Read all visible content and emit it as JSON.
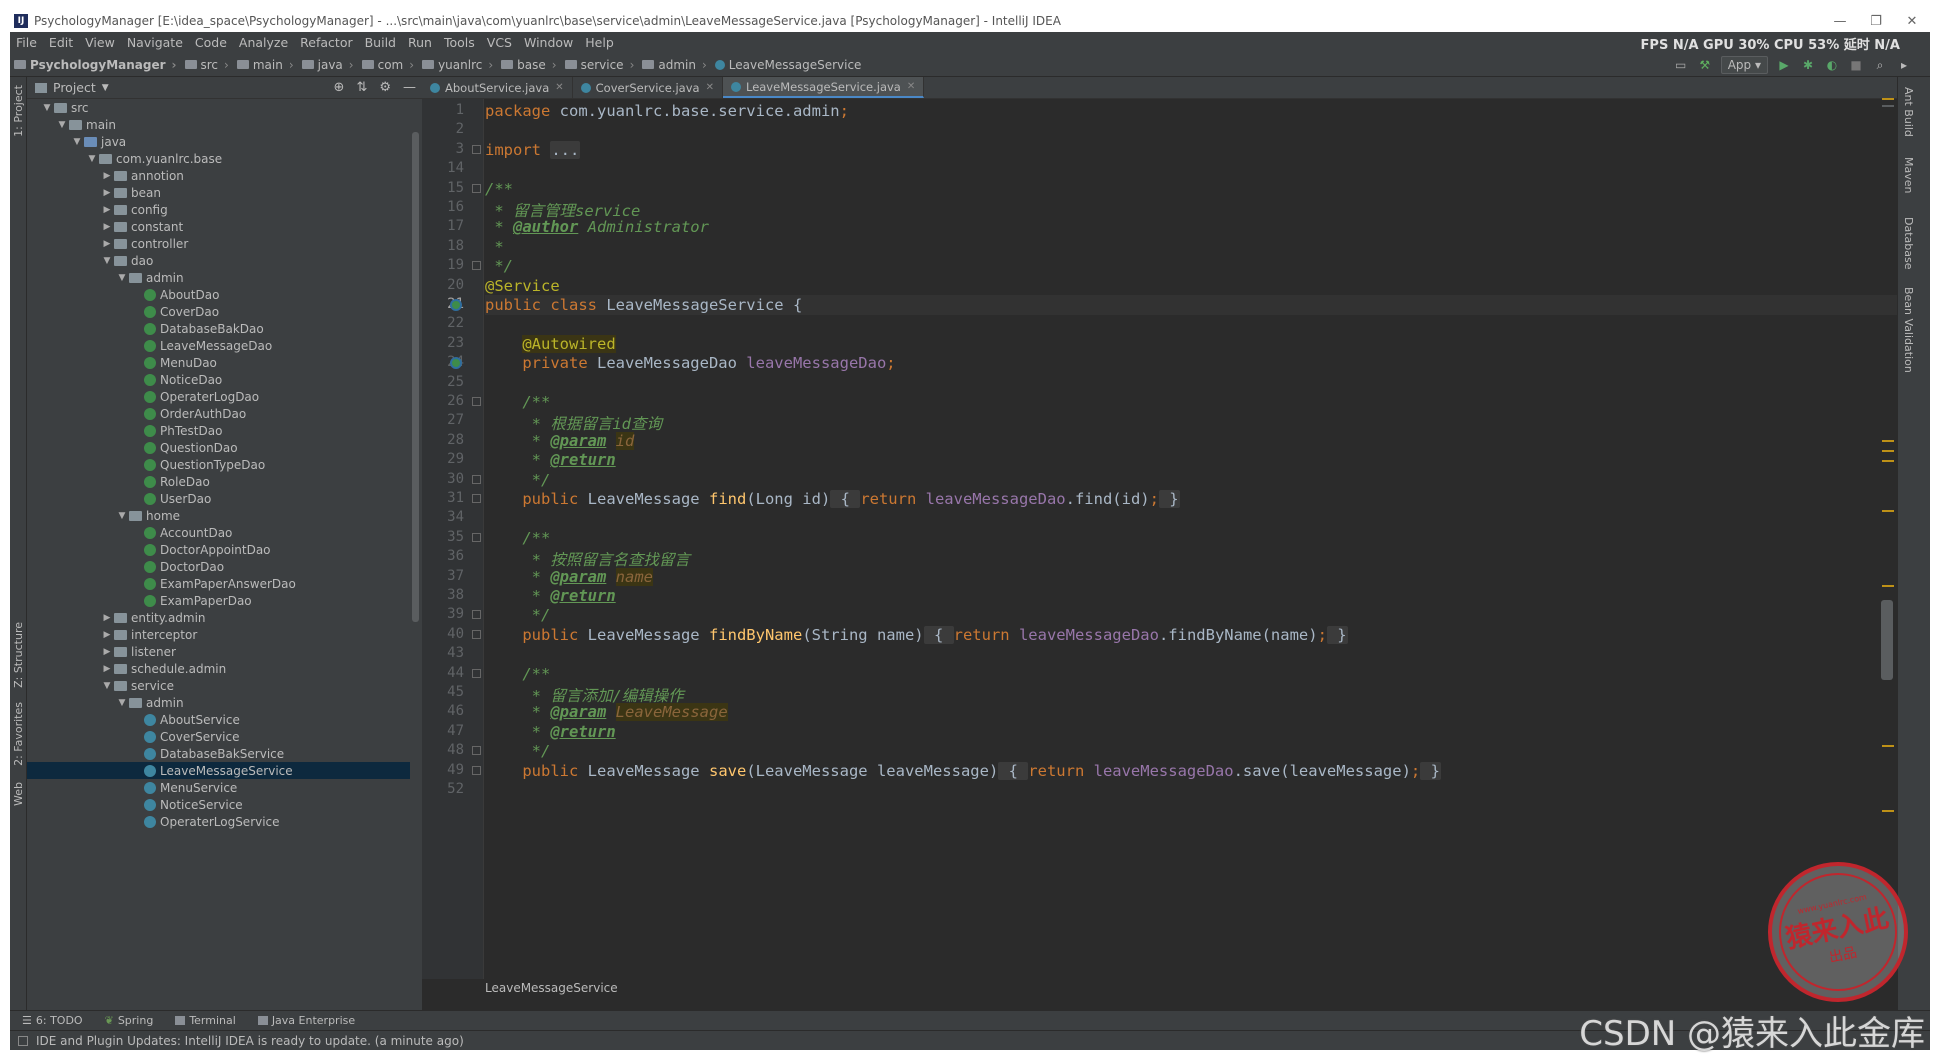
{
  "title": "PsychologyManager [E:\\idea_space\\PsychologyManager] - ...\\src\\main\\java\\com\\yuanlrc\\base\\service\\admin\\LeaveMessageService.java [PsychologyManager] - IntelliJ IDEA",
  "window_controls": {
    "minimize": "—",
    "restore": "❐",
    "close": "✕"
  },
  "menu": [
    "File",
    "Edit",
    "View",
    "Navigate",
    "Code",
    "Analyze",
    "Refactor",
    "Build",
    "Run",
    "Tools",
    "VCS",
    "Window",
    "Help"
  ],
  "stats": "FPS N/A GPU 30% CPU 53% 延时 N/A",
  "breadcrumbs": [
    "PsychologyManager",
    "src",
    "main",
    "java",
    "com",
    "yuanlrc",
    "base",
    "service",
    "admin",
    "LeaveMessageService"
  ],
  "run_config": "App",
  "left_stripe": {
    "project": "1: Project",
    "structure": "Z: Structure",
    "favorites": "2: Favorites",
    "web": "Web"
  },
  "right_stripe": {
    "ant": "Ant Build",
    "maven": "Maven",
    "database": "Database",
    "bean": "Bean Validation"
  },
  "project_panel": {
    "title": "Project"
  },
  "tree": [
    {
      "label": "src",
      "depth": 1,
      "arrow": "▼",
      "kind": "folder"
    },
    {
      "label": "main",
      "depth": 2,
      "arrow": "▼",
      "kind": "folder"
    },
    {
      "label": "java",
      "depth": 3,
      "arrow": "▼",
      "kind": "src"
    },
    {
      "label": "com.yuanlrc.base",
      "depth": 4,
      "arrow": "▼",
      "kind": "folder"
    },
    {
      "label": "annotion",
      "depth": 5,
      "arrow": "▶",
      "kind": "folder"
    },
    {
      "label": "bean",
      "depth": 5,
      "arrow": "▶",
      "kind": "folder"
    },
    {
      "label": "config",
      "depth": 5,
      "arrow": "▶",
      "kind": "folder"
    },
    {
      "label": "constant",
      "depth": 5,
      "arrow": "▶",
      "kind": "folder"
    },
    {
      "label": "controller",
      "depth": 5,
      "arrow": "▶",
      "kind": "folder"
    },
    {
      "label": "dao",
      "depth": 5,
      "arrow": "▼",
      "kind": "folder"
    },
    {
      "label": "admin",
      "depth": 6,
      "arrow": "▼",
      "kind": "folder"
    },
    {
      "label": "AboutDao",
      "depth": 7,
      "arrow": "",
      "kind": "iface"
    },
    {
      "label": "CoverDao",
      "depth": 7,
      "arrow": "",
      "kind": "iface"
    },
    {
      "label": "DatabaseBakDao",
      "depth": 7,
      "arrow": "",
      "kind": "iface"
    },
    {
      "label": "LeaveMessageDao",
      "depth": 7,
      "arrow": "",
      "kind": "iface"
    },
    {
      "label": "MenuDao",
      "depth": 7,
      "arrow": "",
      "kind": "iface"
    },
    {
      "label": "NoticeDao",
      "depth": 7,
      "arrow": "",
      "kind": "iface"
    },
    {
      "label": "OperaterLogDao",
      "depth": 7,
      "arrow": "",
      "kind": "iface"
    },
    {
      "label": "OrderAuthDao",
      "depth": 7,
      "arrow": "",
      "kind": "iface"
    },
    {
      "label": "PhTestDao",
      "depth": 7,
      "arrow": "",
      "kind": "iface"
    },
    {
      "label": "QuestionDao",
      "depth": 7,
      "arrow": "",
      "kind": "iface"
    },
    {
      "label": "QuestionTypeDao",
      "depth": 7,
      "arrow": "",
      "kind": "iface"
    },
    {
      "label": "RoleDao",
      "depth": 7,
      "arrow": "",
      "kind": "iface"
    },
    {
      "label": "UserDao",
      "depth": 7,
      "arrow": "",
      "kind": "iface"
    },
    {
      "label": "home",
      "depth": 6,
      "arrow": "▼",
      "kind": "folder"
    },
    {
      "label": "AccountDao",
      "depth": 7,
      "arrow": "",
      "kind": "iface"
    },
    {
      "label": "DoctorAppointDao",
      "depth": 7,
      "arrow": "",
      "kind": "iface"
    },
    {
      "label": "DoctorDao",
      "depth": 7,
      "arrow": "",
      "kind": "iface"
    },
    {
      "label": "ExamPaperAnswerDao",
      "depth": 7,
      "arrow": "",
      "kind": "iface"
    },
    {
      "label": "ExamPaperDao",
      "depth": 7,
      "arrow": "",
      "kind": "iface"
    },
    {
      "label": "entity.admin",
      "depth": 5,
      "arrow": "▶",
      "kind": "folder"
    },
    {
      "label": "interceptor",
      "depth": 5,
      "arrow": "▶",
      "kind": "folder"
    },
    {
      "label": "listener",
      "depth": 5,
      "arrow": "▶",
      "kind": "folder"
    },
    {
      "label": "schedule.admin",
      "depth": 5,
      "arrow": "▶",
      "kind": "folder"
    },
    {
      "label": "service",
      "depth": 5,
      "arrow": "▼",
      "kind": "folder"
    },
    {
      "label": "admin",
      "depth": 6,
      "arrow": "▼",
      "kind": "folder"
    },
    {
      "label": "AboutService",
      "depth": 7,
      "arrow": "",
      "kind": "cls"
    },
    {
      "label": "CoverService",
      "depth": 7,
      "arrow": "",
      "kind": "cls"
    },
    {
      "label": "DatabaseBakService",
      "depth": 7,
      "arrow": "",
      "kind": "cls"
    },
    {
      "label": "LeaveMessageService",
      "depth": 7,
      "arrow": "",
      "kind": "cls",
      "selected": true
    },
    {
      "label": "MenuService",
      "depth": 7,
      "arrow": "",
      "kind": "cls"
    },
    {
      "label": "NoticeService",
      "depth": 7,
      "arrow": "",
      "kind": "cls"
    },
    {
      "label": "OperaterLogService",
      "depth": 7,
      "arrow": "",
      "kind": "cls"
    }
  ],
  "tabs": [
    {
      "label": "AboutService.java",
      "active": false
    },
    {
      "label": "CoverService.java",
      "active": false
    },
    {
      "label": "LeaveMessageService.java",
      "active": true
    }
  ],
  "code_lines": [
    {
      "n": "1",
      "t": [
        [
          "kw",
          "package "
        ],
        [
          "",
          "com.yuanlrc.base.service.admin"
        ],
        [
          "kw",
          ";"
        ]
      ]
    },
    {
      "n": "2",
      "t": []
    },
    {
      "n": "3",
      "t": [
        [
          "kw",
          "import "
        ],
        [
          "fold",
          "..."
        ]
      ],
      "fold": true
    },
    {
      "n": "14",
      "t": []
    },
    {
      "n": "15",
      "t": [
        [
          "cm",
          "/**"
        ]
      ],
      "fold": true
    },
    {
      "n": "16",
      "t": [
        [
          "cm",
          " * 留言管理service"
        ]
      ]
    },
    {
      "n": "17",
      "t": [
        [
          "cm",
          " * "
        ],
        [
          "tag",
          "@author"
        ],
        [
          "cm",
          " Administrator"
        ]
      ]
    },
    {
      "n": "18",
      "t": [
        [
          "cm",
          " *"
        ]
      ]
    },
    {
      "n": "19",
      "t": [
        [
          "cm",
          " */"
        ]
      ],
      "fold": true
    },
    {
      "n": "20",
      "t": [
        [
          "ann",
          "@Service"
        ]
      ]
    },
    {
      "n": "21",
      "t": [
        [
          "kw",
          "public class "
        ],
        [
          "",
          "LeaveMessageService {"
        ]
      ],
      "current": true,
      "gicon": true
    },
    {
      "n": "22",
      "t": []
    },
    {
      "n": "23",
      "t": [
        [
          "",
          "    "
        ],
        [
          "annhl",
          "@Autowired"
        ]
      ]
    },
    {
      "n": "24",
      "t": [
        [
          "kw",
          "    private "
        ],
        [
          "",
          "LeaveMessageDao "
        ],
        [
          "fld",
          "leaveMessageDao"
        ],
        [
          "kw",
          ";"
        ]
      ],
      "gicon": true
    },
    {
      "n": "25",
      "t": []
    },
    {
      "n": "26",
      "t": [
        [
          "cm",
          "    /**"
        ]
      ],
      "fold": true
    },
    {
      "n": "27",
      "t": [
        [
          "cm",
          "     * 根据留言id查询"
        ]
      ]
    },
    {
      "n": "28",
      "t": [
        [
          "cm",
          "     * "
        ],
        [
          "tag",
          "@param"
        ],
        [
          "cm",
          " "
        ],
        [
          "pn",
          "id"
        ]
      ]
    },
    {
      "n": "29",
      "t": [
        [
          "cm",
          "     * "
        ],
        [
          "tag",
          "@return"
        ]
      ]
    },
    {
      "n": "30",
      "t": [
        [
          "cm",
          "     */"
        ]
      ],
      "fold": true
    },
    {
      "n": "31",
      "t": [
        [
          "kw",
          "    public "
        ],
        [
          "",
          "LeaveMessage "
        ],
        [
          "mth",
          "find"
        ],
        [
          "",
          "(Long id)"
        ],
        [
          "fold",
          " { "
        ],
        [
          "kw",
          "return "
        ],
        [
          "fld",
          "leaveMessageDao"
        ],
        [
          "",
          ".find(id)"
        ],
        [
          "kw",
          ";"
        ],
        [
          "fold",
          " }"
        ]
      ],
      "fold": true
    },
    {
      "n": "34",
      "t": []
    },
    {
      "n": "35",
      "t": [
        [
          "cm",
          "    /**"
        ]
      ],
      "fold": true
    },
    {
      "n": "36",
      "t": [
        [
          "cm",
          "     * 按照留言名查找留言"
        ]
      ]
    },
    {
      "n": "37",
      "t": [
        [
          "cm",
          "     * "
        ],
        [
          "tag",
          "@param"
        ],
        [
          "cm",
          " "
        ],
        [
          "pn",
          "name"
        ]
      ]
    },
    {
      "n": "38",
      "t": [
        [
          "cm",
          "     * "
        ],
        [
          "tag",
          "@return"
        ]
      ]
    },
    {
      "n": "39",
      "t": [
        [
          "cm",
          "     */"
        ]
      ],
      "fold": true
    },
    {
      "n": "40",
      "t": [
        [
          "kw",
          "    public "
        ],
        [
          "",
          "LeaveMessage "
        ],
        [
          "mth",
          "findByName"
        ],
        [
          "",
          "(String name)"
        ],
        [
          "fold",
          " { "
        ],
        [
          "kw",
          "return "
        ],
        [
          "fld",
          "leaveMessageDao"
        ],
        [
          "",
          ".findByName(name)"
        ],
        [
          "kw",
          ";"
        ],
        [
          "fold",
          " }"
        ]
      ],
      "fold": true
    },
    {
      "n": "43",
      "t": []
    },
    {
      "n": "44",
      "t": [
        [
          "cm",
          "    /**"
        ]
      ],
      "fold": true
    },
    {
      "n": "45",
      "t": [
        [
          "cm",
          "     * 留言添加/编辑操作"
        ]
      ]
    },
    {
      "n": "46",
      "t": [
        [
          "cm",
          "     * "
        ],
        [
          "tag",
          "@param"
        ],
        [
          "cm",
          " "
        ],
        [
          "pn",
          "LeaveMessage"
        ]
      ]
    },
    {
      "n": "47",
      "t": [
        [
          "cm",
          "     * "
        ],
        [
          "tag",
          "@return"
        ]
      ]
    },
    {
      "n": "48",
      "t": [
        [
          "cm",
          "     */"
        ]
      ],
      "fold": true
    },
    {
      "n": "49",
      "t": [
        [
          "kw",
          "    public "
        ],
        [
          "",
          "LeaveMessage "
        ],
        [
          "mth",
          "save"
        ],
        [
          "",
          "(LeaveMessage leaveMessage)"
        ],
        [
          "fold",
          " { "
        ],
        [
          "kw",
          "return "
        ],
        [
          "fld",
          "leaveMessageDao"
        ],
        [
          "",
          ".save(leaveMessage)"
        ],
        [
          "kw",
          ";"
        ],
        [
          "fold",
          " }"
        ]
      ],
      "fold": true
    },
    {
      "n": "52",
      "t": []
    }
  ],
  "editor_breadcrumb": "LeaveMessageService",
  "bottom_tools": [
    "6: TODO",
    "Spring",
    "Terminal",
    "Java Enterprise"
  ],
  "status_message": "IDE and Plugin Updates: IntelliJ IDEA is ready to update. (a minute ago)",
  "watermark": {
    "stamp_url": "www.yuanlrc.com",
    "stamp_main": "猿来入此",
    "stamp_sub": "出品",
    "csdn": "CSDN @猿来入此金库"
  },
  "colors": {
    "bg": "#2b2b2b",
    "keyword": "#cc7832",
    "annotation": "#bbb529",
    "comment": "#629755",
    "field": "#9876aa",
    "method": "#ffc66d"
  }
}
